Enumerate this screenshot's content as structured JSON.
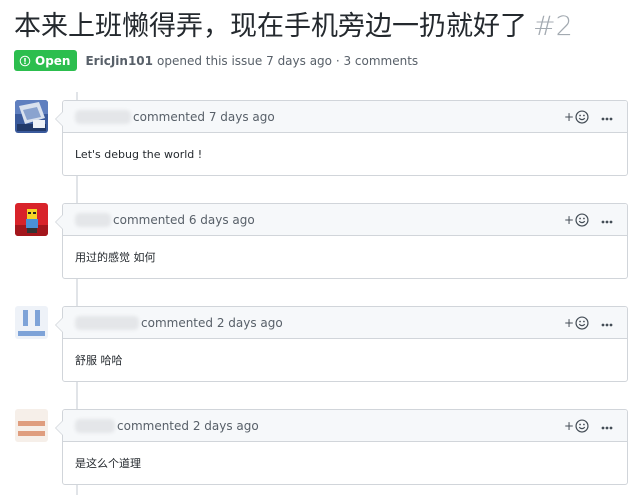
{
  "issue": {
    "title": "本来上班懒得弄，现在手机旁边一扔就好了",
    "number": "#2",
    "state": "Open",
    "author": "EricJin101",
    "opened_text": "opened this issue 7 days ago · 3 comments"
  },
  "actions": {
    "reaction_plus": "+",
    "reaction_icon": "smiley-icon",
    "more_icon": "kebab-horizontal-icon"
  },
  "comments": [
    {
      "timestamp": "commented 7 days ago",
      "body": "Let's debug the world !"
    },
    {
      "timestamp": "commented 6 days ago",
      "body": "用过的感觉 如何"
    },
    {
      "timestamp": "commented 2 days ago",
      "body": "舒服 哈哈"
    },
    {
      "timestamp": "commented 2 days ago",
      "body": "是这么个道理"
    }
  ],
  "colors": {
    "open_badge": "#2cbe4e",
    "header_bg": "#f6f8fa",
    "border": "#d1d5da"
  }
}
